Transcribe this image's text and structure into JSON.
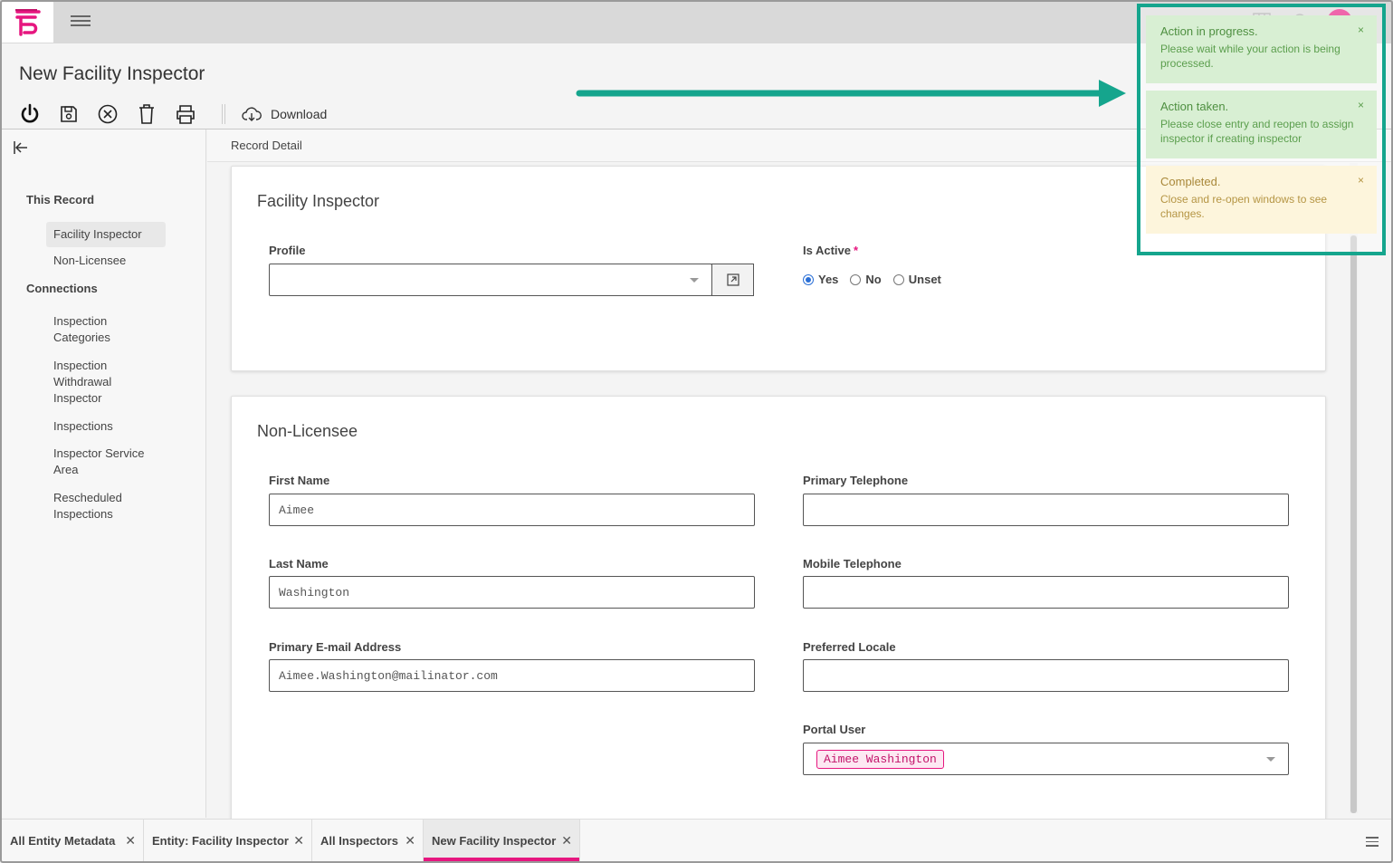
{
  "header": {
    "page_title": "New Facility Inspector",
    "download_label": "Download"
  },
  "sidebar": {
    "this_record_label": "This Record",
    "connections_label": "Connections",
    "this_record_items": [
      "Facility Inspector",
      "Non-Licensee"
    ],
    "connections_items": [
      "Inspection Categories",
      "Inspection Withdrawal Inspector",
      "Inspections",
      "Inspector Service Area",
      "Rescheduled Inspections"
    ]
  },
  "breadcrumb": "Record Detail",
  "facility_inspector": {
    "title": "Facility Inspector",
    "profile_label": "Profile",
    "profile_value": "",
    "is_active_label": "Is Active",
    "required_mark": "*",
    "options": [
      "Yes",
      "No",
      "Unset"
    ],
    "selected": "Yes"
  },
  "non_licensee": {
    "title": "Non-Licensee",
    "first_name_label": "First Name",
    "first_name_value": "Aimee",
    "last_name_label": "Last Name",
    "last_name_value": "Washington",
    "email_label": "Primary E-mail Address",
    "email_value": "Aimee.Washington@mailinator.com",
    "primary_phone_label": "Primary Telephone",
    "primary_phone_value": "",
    "mobile_phone_label": "Mobile Telephone",
    "mobile_phone_value": "",
    "locale_label": "Preferred Locale",
    "locale_value": "",
    "portal_user_label": "Portal User",
    "portal_user_value": "Aimee Washington"
  },
  "toasts": [
    {
      "title": "Action in progress.",
      "message": "Please wait while your action is being processed.",
      "type": "success"
    },
    {
      "title": "Action taken.",
      "message": "Please close entry and reopen to assign inspector if creating inspector",
      "type": "success"
    },
    {
      "title": "Completed.",
      "message": "Close and re-open windows to see changes.",
      "type": "warning"
    }
  ],
  "toast_close": "×",
  "bottom_tabs": [
    {
      "label": "All Entity Metadata",
      "close": "✕"
    },
    {
      "label": "Entity: Facility Inspector",
      "close": "✕"
    },
    {
      "label": "All Inspectors",
      "close": "✕"
    },
    {
      "label": "New Facility Inspector",
      "close": "✕",
      "active": true
    }
  ],
  "colors": {
    "brand": "#e6167f",
    "highlight": "#15a58d",
    "success_bg": "#d8efd3",
    "warning_bg": "#fdf5dc"
  },
  "icons": [
    "logo-icon",
    "hamburger-icon",
    "grid-icon",
    "bell-icon",
    "power-icon",
    "save-icon",
    "cancel-icon",
    "trash-icon",
    "print-icon",
    "cloud-download-icon",
    "collapse-left-icon",
    "open-external-icon",
    "chevron-down-icon",
    "menu-icon"
  ]
}
